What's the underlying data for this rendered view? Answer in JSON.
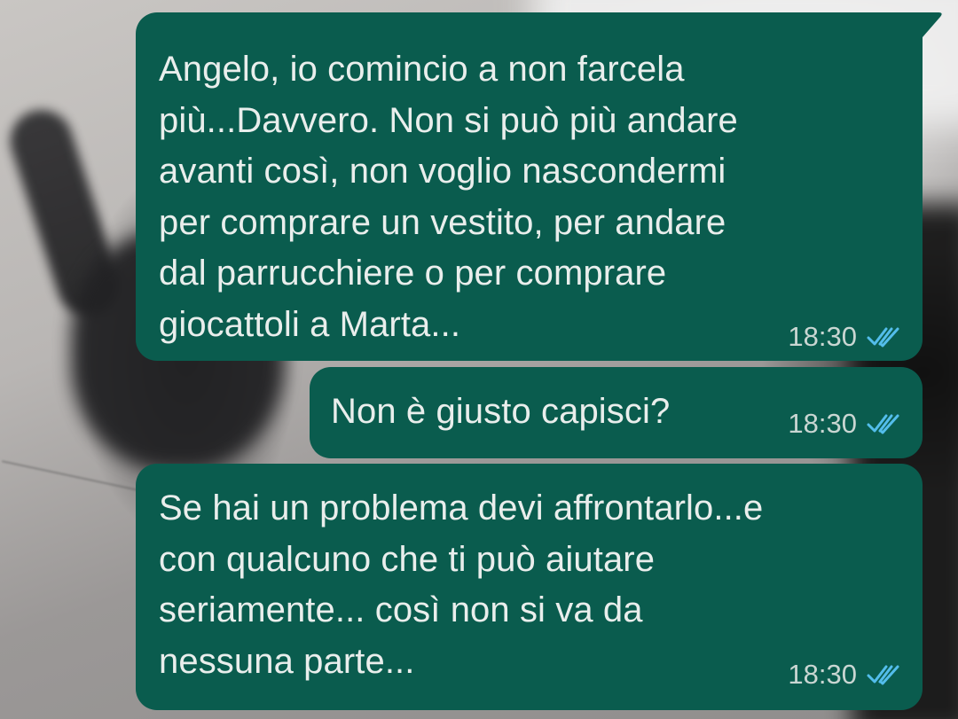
{
  "conversation": {
    "messages": [
      {
        "text": "Angelo, io comincio a non farcela\npiù...Davvero. Non si può più andare\navanti così, non voglio nascondermi\nper comprare un vestito, per andare\ndal parrucchiere o per comprare\ngiocattoli a Marta...",
        "time": "18:30",
        "status_icon": "double-check-read-icon"
      },
      {
        "text": "Non è giusto capisci?",
        "time": "18:30",
        "status_icon": "double-check-read-icon"
      },
      {
        "text": "Se hai un problema devi affrontarlo...e\ncon qualcuno che ti può aiutare\nseriamente... così non si va da\nnessuna parte...",
        "time": "18:30",
        "status_icon": "double-check-read-icon"
      }
    ]
  },
  "colors": {
    "bubble": "#0a5c4e",
    "text": "#e9eeec",
    "read_ticks": "#53bdeb"
  }
}
